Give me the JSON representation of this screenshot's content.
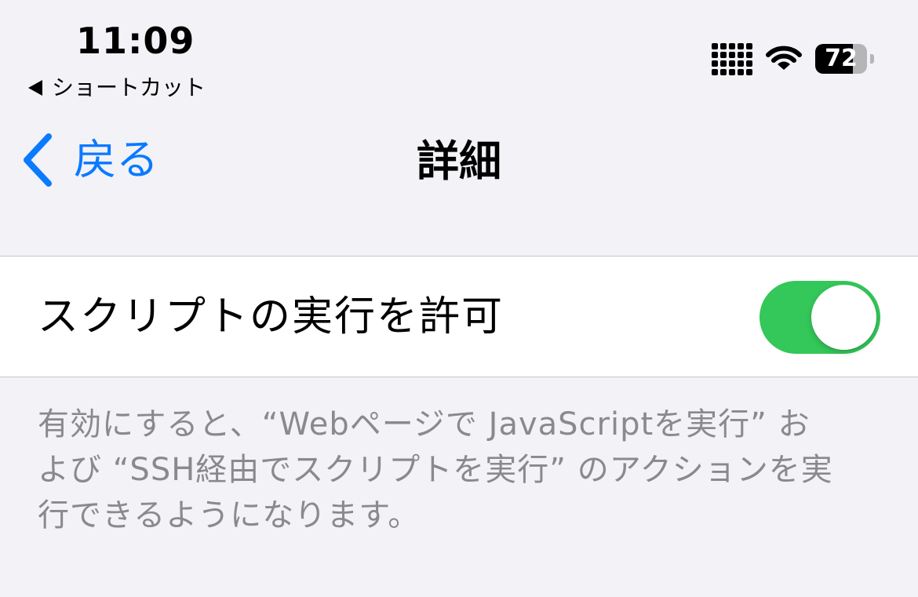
{
  "status_bar": {
    "time": "11:09",
    "back_app_label": "ショートカット",
    "battery_percent": "72",
    "battery_level": 0.72
  },
  "nav": {
    "back_label": "戻る",
    "title": "詳細"
  },
  "settings": {
    "allow_scripts_label": "スクリプトの実行を許可",
    "allow_scripts_enabled": true,
    "toggle_on_color": "#34c759"
  },
  "footer": {
    "description": "有効にすると、“Webページで JavaScriptを実行” および “SSH経由でスクリプトを実行” のアクションを実行できるようになります。"
  },
  "colors": {
    "accent": "#0a7aff",
    "background": "#f2f2f7"
  }
}
